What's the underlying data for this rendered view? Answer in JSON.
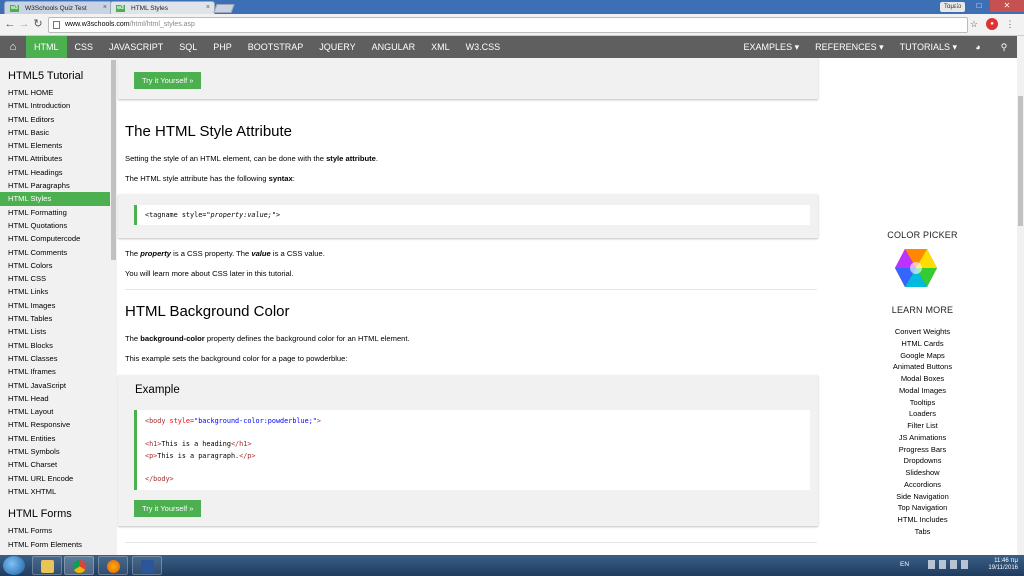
{
  "browser": {
    "tabs": [
      {
        "label": "W3Schools Quiz Test",
        "favicon": "w3"
      },
      {
        "label": "HTML Styles",
        "favicon": "w3"
      }
    ],
    "profile": "Ταμείο",
    "url_host": "www.w3schools.com",
    "url_path": "/html/html_styles.asp"
  },
  "topnav": {
    "items": [
      "HTML",
      "CSS",
      "JAVASCRIPT",
      "SQL",
      "PHP",
      "BOOTSTRAP",
      "JQUERY",
      "ANGULAR",
      "XML",
      "W3.CSS"
    ],
    "right": [
      "EXAMPLES ▾",
      "REFERENCES ▾",
      "TUTORIALS ▾"
    ],
    "accent": "#4caf50"
  },
  "sidebar": {
    "section1": "HTML5 Tutorial",
    "links1": [
      "HTML HOME",
      "HTML Introduction",
      "HTML Editors",
      "HTML Basic",
      "HTML Elements",
      "HTML Attributes",
      "HTML Headings",
      "HTML Paragraphs",
      "HTML Styles",
      "HTML Formatting",
      "HTML Quotations",
      "HTML Computercode",
      "HTML Comments",
      "HTML Colors",
      "HTML CSS",
      "HTML Links",
      "HTML Images",
      "HTML Tables",
      "HTML Lists",
      "HTML Blocks",
      "HTML Classes",
      "HTML Iframes",
      "HTML JavaScript",
      "HTML Head",
      "HTML Layout",
      "HTML Responsive",
      "HTML Entities",
      "HTML Symbols",
      "HTML Charset",
      "HTML URL Encode",
      "HTML XHTML"
    ],
    "section2": "HTML Forms",
    "links2": [
      "HTML Forms",
      "HTML Form Elements"
    ]
  },
  "main": {
    "try_label": "Try it Yourself »",
    "style_heading": "The HTML Style Attribute",
    "p1_pre": "Setting the style of an HTML element, can be done with the ",
    "p1_bold": "style attribute",
    "p1_post": ".",
    "p2_pre": "The HTML style attribute has the following ",
    "p2_bold": "syntax",
    "p2_post": ":",
    "syntax_pre": "<tagname style=\"",
    "syntax_italic": "property:value;",
    "syntax_post": "\">",
    "p3_a": "The ",
    "p3_property": "property",
    "p3_b": " is a CSS property. The ",
    "p3_value": "value",
    "p3_c": " is a CSS value.",
    "p4": "You will learn more about CSS later in this tutorial.",
    "bg_heading": "HTML Background Color",
    "p5_pre": "The ",
    "p5_bold": "background-color",
    "p5_post": " property defines the background color for an HTML element.",
    "p6": "This example sets the background color for a page to powderblue:",
    "example_title": "Example",
    "code": {
      "body_open_tag": "<body",
      "body_attr": " style=",
      "body_val": "\"background-color:powderblue;\"",
      "body_close_bracket": ">",
      "h1_open": "<h1>",
      "h1_text": "This is a heading",
      "h1_close": "</h1>",
      "p_open": "<p>",
      "p_text": "This is a paragraph.",
      "p_close": "</p>",
      "body_close": "</body>"
    }
  },
  "rightcol": {
    "color_picker": "COLOR PICKER",
    "learn_more": "LEARN MORE",
    "links": [
      "Convert Weights",
      "HTML Cards",
      "Google Maps",
      "Animated Buttons",
      "Modal Boxes",
      "Modal Images",
      "Tooltips",
      "Loaders",
      "Filter List",
      "JS Animations",
      "Progress Bars",
      "Dropdowns",
      "Slideshow",
      "Accordions",
      "Side Navigation",
      "Top Navigation",
      "HTML Includes",
      "Tabs"
    ]
  },
  "taskbar": {
    "lang": "EN",
    "time": "11:46 πμ",
    "date": "19/11/2016"
  }
}
